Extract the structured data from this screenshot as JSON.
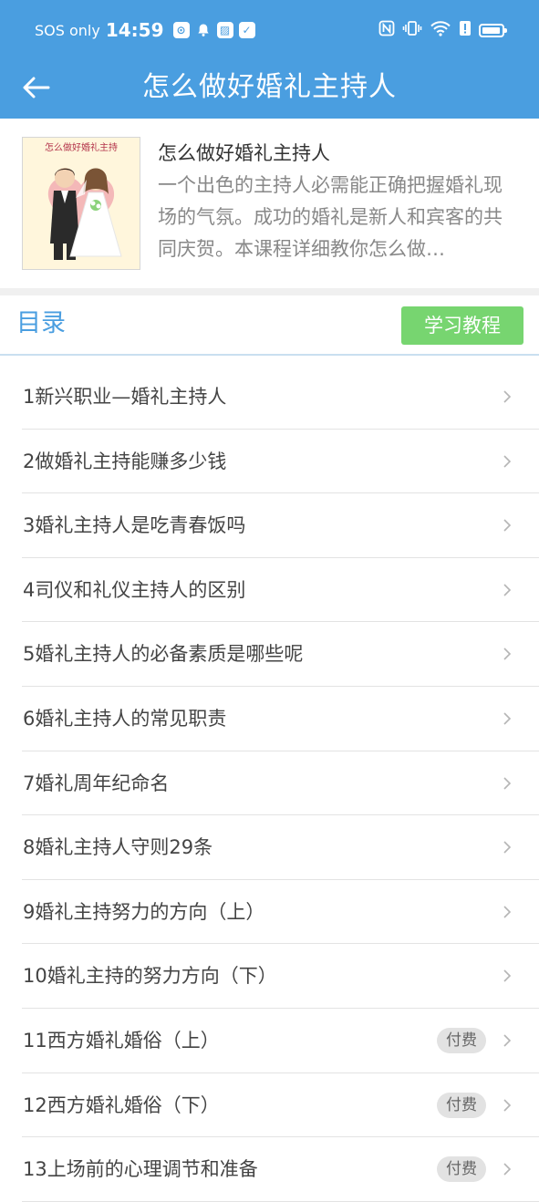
{
  "status_bar": {
    "sos": "SOS only",
    "time": "14:59",
    "battery_level": 0.8
  },
  "header": {
    "title": "怎么做好婚礼主持人"
  },
  "course": {
    "cover_text": "怎么做好婚礼主持",
    "name": "怎么做好婚礼主持人",
    "description": "一个出色的主持人必需能正确把握婚礼现场的气氛。成功的婚礼是新人和宾客的共同庆贺。本课程详细教你怎么做…"
  },
  "toc": {
    "title": "目录",
    "study_button": "学习教程"
  },
  "chapters": [
    {
      "label": "1新兴职业—婚礼主持人",
      "badge": ""
    },
    {
      "label": "2做婚礼主持能赚多少钱",
      "badge": ""
    },
    {
      "label": "3婚礼主持人是吃青春饭吗",
      "badge": ""
    },
    {
      "label": "4司仪和礼仪主持人的区别",
      "badge": ""
    },
    {
      "label": "5婚礼主持人的必备素质是哪些呢",
      "badge": ""
    },
    {
      "label": "6婚礼主持人的常见职责",
      "badge": ""
    },
    {
      "label": "7婚礼周年纪命名",
      "badge": ""
    },
    {
      "label": "8婚礼主持人守则29条",
      "badge": ""
    },
    {
      "label": "9婚礼主持努力的方向（上）",
      "badge": ""
    },
    {
      "label": "10婚礼主持的努力方向（下）",
      "badge": ""
    },
    {
      "label": "11西方婚礼婚俗（上）",
      "badge": "付费"
    },
    {
      "label": "12西方婚礼婚俗（下）",
      "badge": "付费"
    },
    {
      "label": "13上场前的心理调节和准备",
      "badge": "付费"
    }
  ],
  "colors": {
    "primary": "#4a9ee0",
    "study_button": "#77d570",
    "badge_bg": "#e2e2e2"
  }
}
